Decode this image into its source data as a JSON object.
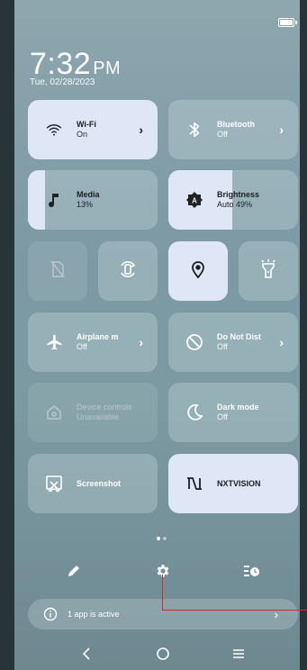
{
  "time": {
    "clock": "7:32",
    "ampm": "PM",
    "date": "Tue, 02/28/2023"
  },
  "tiles": {
    "wifi": {
      "title": "Wi-Fi",
      "state": "On",
      "icon": "wifi-icon"
    },
    "bluetooth": {
      "title": "Bluetooth",
      "state": "Off",
      "icon": "bluetooth-icon"
    },
    "media": {
      "title": "Media",
      "value": "13%",
      "fill": 0.13,
      "icon": "music-note-icon"
    },
    "brightness": {
      "title": "Brightness",
      "value": "Auto 49%",
      "fill": 0.49,
      "icon": "brightness-icon"
    },
    "airplane": {
      "title": "Airplane m",
      "state": "Off",
      "icon": "airplane-icon"
    },
    "dnd": {
      "title": "Do Not Dist",
      "state": "Off",
      "icon": "do-not-disturb-icon"
    },
    "device_controls": {
      "title": "Device controls",
      "state": "Unavailable",
      "icon": "home-icon"
    },
    "dark_mode": {
      "title": "Dark mode",
      "state": "Off",
      "icon": "moon-icon"
    },
    "screenshot": {
      "title": "Screenshot",
      "icon": "screenshot-icon"
    },
    "nxtvision": {
      "title": "NXTVISION",
      "icon": "nxtvision-icon"
    }
  },
  "small_tiles": [
    {
      "name": "no-sim-icon",
      "active": false,
      "disabled": true
    },
    {
      "name": "auto-rotate-icon",
      "active": false,
      "disabled": false
    },
    {
      "name": "location-icon",
      "active": true,
      "disabled": false
    },
    {
      "name": "flashlight-icon",
      "active": false,
      "disabled": false
    }
  ],
  "bottom": {
    "active_apps_label": "1 app is active",
    "icons": [
      "edit-icon",
      "settings-icon",
      "alarm-icon"
    ]
  },
  "nav": [
    "back-icon",
    "home-icon",
    "recents-icon"
  ],
  "colors": {
    "active_tile": "#dfe7f6",
    "annotation_line": "#d42a2a"
  }
}
